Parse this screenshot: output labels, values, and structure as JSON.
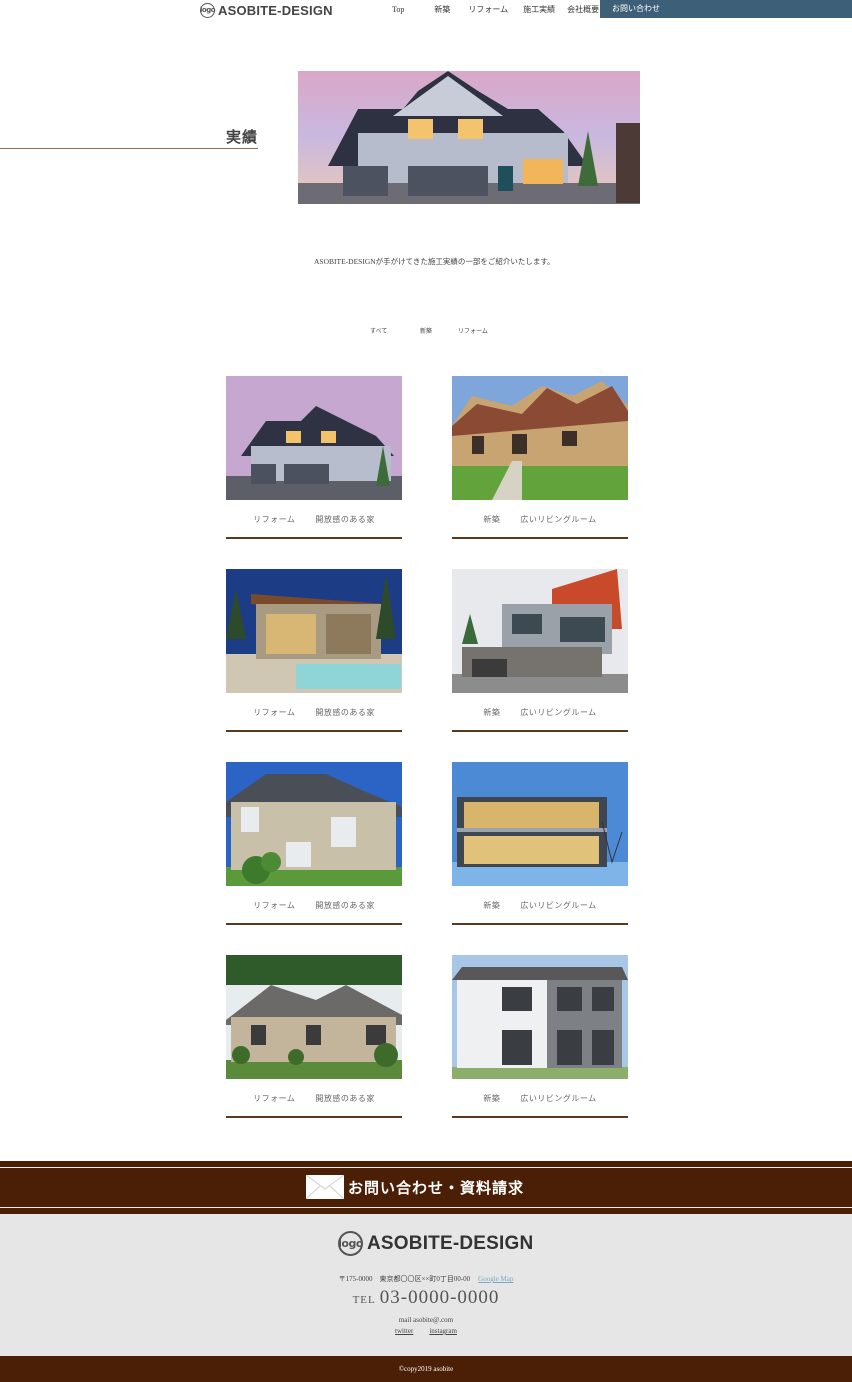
{
  "header": {
    "logo_mark": "logo",
    "brand": "ASOBITE-DESIGN",
    "nav": [
      "Top",
      "新築",
      "リフォーム",
      "施工実績",
      "会社概要"
    ],
    "cta": "お問い合わせ"
  },
  "hero": {
    "title": "実績",
    "intro": "ASOBITE-DESIGNが手がけてきた施工実績の一部をご紹介いたします。"
  },
  "filters": [
    "すべて",
    "新築",
    "リフォーム"
  ],
  "works": [
    {
      "category": "リフォーム",
      "title": "開放感のある家"
    },
    {
      "category": "新築",
      "title": "広いリビングルーム"
    },
    {
      "category": "リフォーム",
      "title": "開放感のある家"
    },
    {
      "category": "新築",
      "title": "広いリビングルーム"
    },
    {
      "category": "リフォーム",
      "title": "開放感のある家"
    },
    {
      "category": "新築",
      "title": "広いリビングルーム"
    },
    {
      "category": "リフォーム",
      "title": "開放感のある家"
    },
    {
      "category": "新築",
      "title": "広いリビングルーム"
    }
  ],
  "contact": {
    "label": "お問い合わせ・資料請求"
  },
  "footer": {
    "logo_mark": "logo",
    "brand": "ASOBITE-DESIGN",
    "address": "〒175-0000　東京都〇〇区××町0丁目00-00",
    "map_link": "Google Map",
    "tel_prefix": "TEL",
    "tel": "03-0000-0000",
    "mail": "mail asobite@.com",
    "sns": [
      "twitter",
      "instagram"
    ],
    "copyright": "©copy2019 asobite"
  },
  "colors": {
    "brand_brown": "#4a1f05",
    "nav_cta": "#3d5f78",
    "footer_bg": "#e6e6e6"
  }
}
